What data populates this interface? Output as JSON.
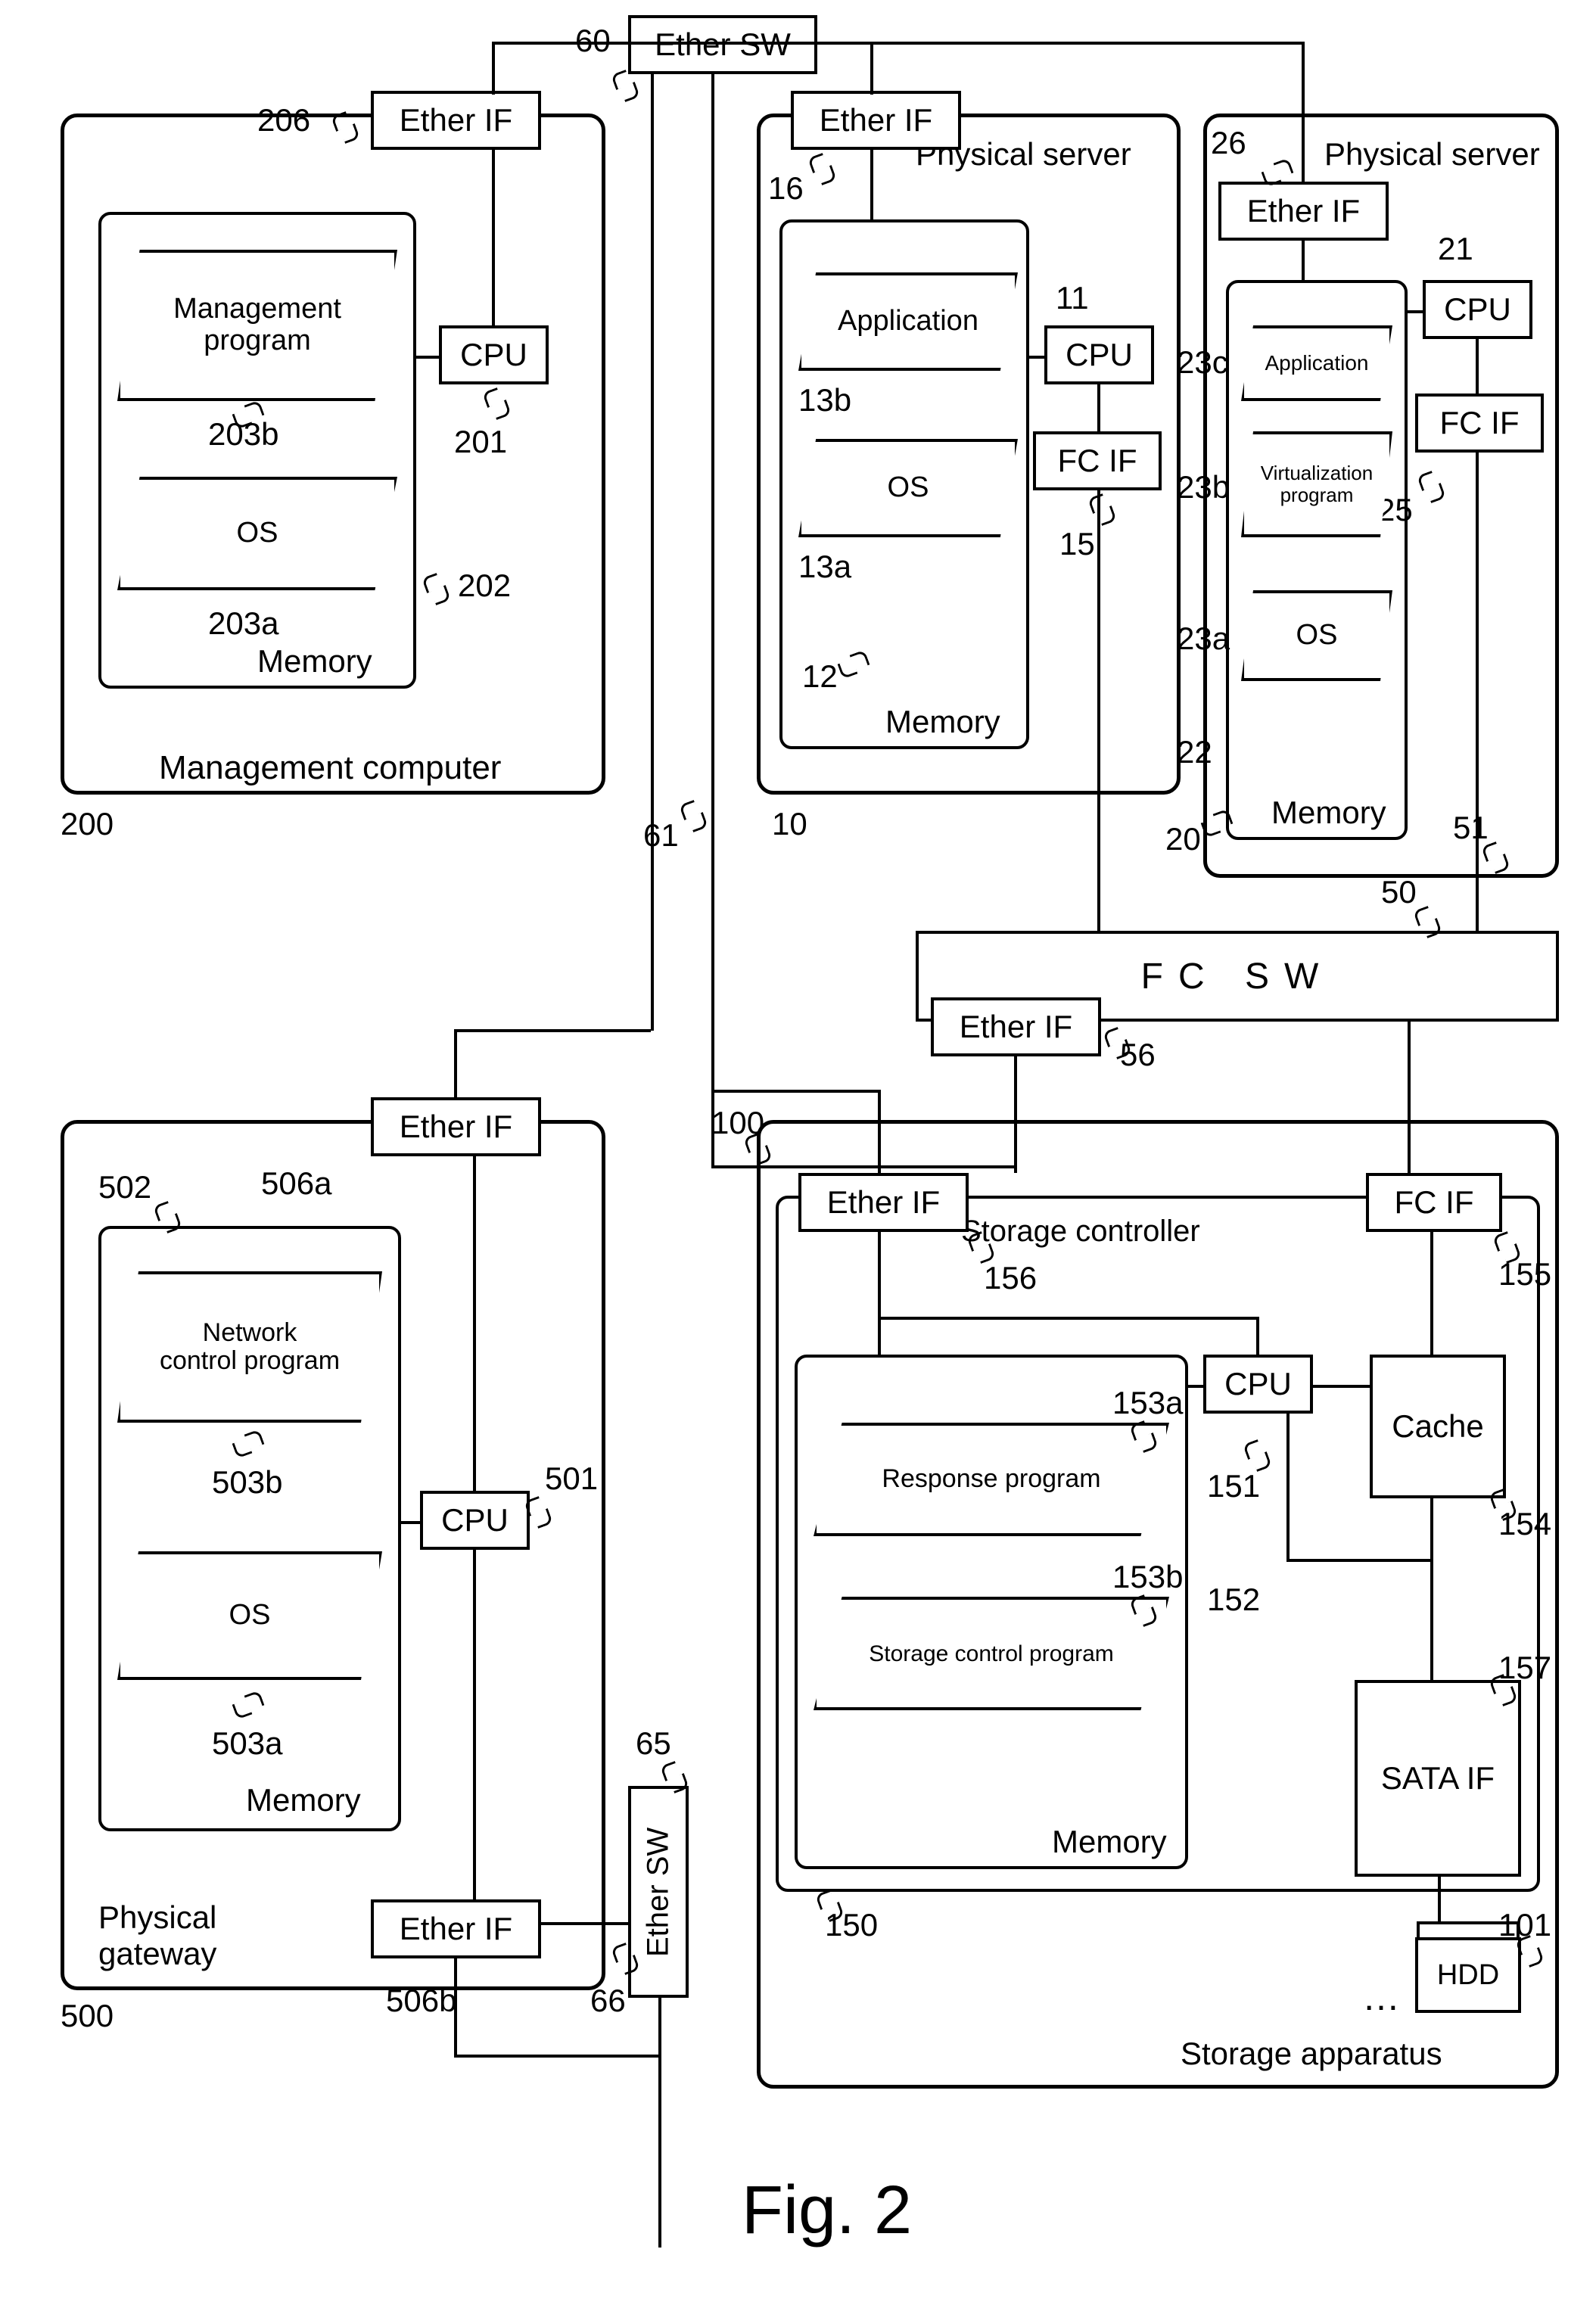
{
  "figure_label": "Fig. 2",
  "management_computer": {
    "ref": "200",
    "name": "Management computer",
    "ether_if": {
      "label": "Ether IF",
      "ref": "206"
    },
    "cpu": {
      "label": "CPU",
      "ref": "201"
    },
    "memory": {
      "label": "Memory",
      "ref": "202"
    },
    "program": {
      "label": "Management\nprogram",
      "ref": "203b"
    },
    "os": {
      "label": "OS",
      "ref": "203a"
    }
  },
  "physical_gateway": {
    "ref": "500",
    "name": "Physical\ngateway",
    "ether_if_a": {
      "label": "Ether IF",
      "ref": "506a"
    },
    "ether_if_b": {
      "label": "Ether IF",
      "ref": "506b"
    },
    "cpu": {
      "label": "CPU",
      "ref": "501"
    },
    "memory": {
      "label": "Memory",
      "ref": "502"
    },
    "program": {
      "label": "Network\ncontrol program",
      "ref": "503b"
    },
    "os": {
      "label": "OS",
      "ref": "503a"
    }
  },
  "physical_server_1": {
    "ref": "10",
    "name": "Physical server",
    "ether_if": {
      "label": "Ether IF",
      "ref": "16"
    },
    "cpu": {
      "label": "CPU",
      "ref": "11"
    },
    "fc_if": {
      "label": "FC IF",
      "ref": "15"
    },
    "memory": {
      "label": "Memory",
      "ref": "12"
    },
    "application": {
      "label": "Application",
      "ref": "13b"
    },
    "os": {
      "label": "OS",
      "ref": "13a"
    }
  },
  "physical_server_2": {
    "ref": "20",
    "name": "Physical server",
    "ether_if": {
      "label": "Ether IF",
      "ref": "26"
    },
    "cpu": {
      "label": "CPU",
      "ref": "21"
    },
    "fc_if": {
      "label": "FC IF",
      "ref": "25"
    },
    "memory": {
      "label": "Memory",
      "ref": "22"
    },
    "application": {
      "label": "Application",
      "ref": "23c"
    },
    "virtualization": {
      "label": "Virtualization\nprogram",
      "ref": "23b"
    },
    "os": {
      "label": "OS",
      "ref": "23a"
    }
  },
  "ether_sw_1": {
    "label": "Ether SW",
    "ref": "60",
    "conn_ref": "61"
  },
  "ether_sw_2": {
    "label": "Ether SW",
    "ref": "65",
    "conn_ref": "66"
  },
  "fc_sw": {
    "label": "FC   SW",
    "ref": "50",
    "ether_if": {
      "label": "Ether IF",
      "ref": "56"
    },
    "conn_ref": "51"
  },
  "storage_apparatus": {
    "ref": "100",
    "name": "Storage apparatus",
    "controller_name": "Storage controller",
    "controller_ref": "150",
    "ether_if": {
      "label": "Ether IF",
      "ref": "156"
    },
    "fc_if": {
      "label": "FC IF",
      "ref": "155"
    },
    "cpu": {
      "label": "CPU",
      "ref": "151"
    },
    "cache": {
      "label": "Cache",
      "ref": "154"
    },
    "sata_if": {
      "label": "SATA IF",
      "ref": "157"
    },
    "memory": {
      "label": "Memory",
      "ref": "152"
    },
    "response_prog": {
      "label": "Response program",
      "ref": "153a"
    },
    "storage_prog": {
      "label": "Storage control program",
      "ref": "153b"
    },
    "hdd": {
      "label": "HDD",
      "ref": "101"
    },
    "hdd_more": "…"
  }
}
